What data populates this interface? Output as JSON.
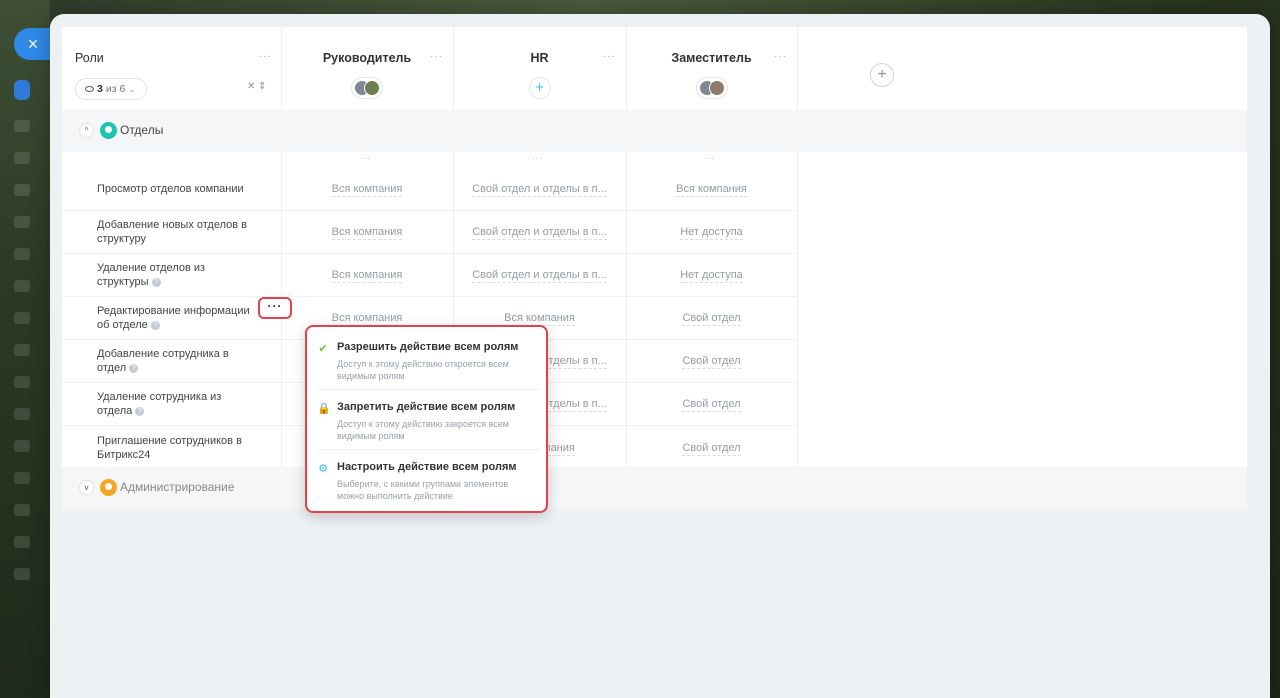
{
  "close_button": "×",
  "header": {
    "roles_title": "Роли",
    "dots": "···",
    "visible_count": "3",
    "visible_of": "из 6",
    "roles": [
      {
        "name": "Руководитель",
        "has_avatars": true
      },
      {
        "name": "HR",
        "has_avatars": false
      },
      {
        "name": "Заместитель",
        "has_avatars": true
      }
    ],
    "add_role_label": "+"
  },
  "sections": [
    {
      "label": "Отделы",
      "expanded": true,
      "icon": "people-icon",
      "color": "#1ec6b0"
    },
    {
      "label": "Администрирование",
      "expanded": false,
      "icon": "person-icon",
      "color": "#f6a623"
    }
  ],
  "permissions": [
    {
      "label": "Просмотр отделов компании",
      "help": false,
      "values": [
        "Вся компания",
        "Свой отдел и отделы в п...",
        "Вся компания"
      ]
    },
    {
      "label": "Добавление новых отделов в структуру",
      "help": false,
      "values": [
        "Вся компания",
        "Свой отдел и отделы в п...",
        "Нет доступа"
      ]
    },
    {
      "label": "Удаление отделов из структуры",
      "help": true,
      "values": [
        "Вся компания",
        "Свой отдел и отделы в п...",
        "Нет доступа"
      ]
    },
    {
      "label": "Редактирование информации об отделе",
      "help": true,
      "values": [
        "Вся компания",
        "Вся компания",
        "Свой отдел"
      ]
    },
    {
      "label": "Добавление сотрудника в отдел",
      "help": true,
      "values": [
        "",
        "Свой отдел и отделы в п...",
        "Свой отдел"
      ]
    },
    {
      "label": "Удаление сотрудника из отдела",
      "help": true,
      "values": [
        "",
        "Свой отдел и отделы в п...",
        "Свой отдел"
      ]
    },
    {
      "label": "Приглашение сотрудников в Битрикс24",
      "help": false,
      "values": [
        "",
        "Вся компания",
        "Свой отдел"
      ]
    }
  ],
  "row_menu": {
    "button_label": "···",
    "items": [
      {
        "title": "Разрешить действие всем ролям",
        "desc": "Доступ к этому действию откроется всем видимым ролям",
        "icon": "check-icon",
        "glyph": "✔"
      },
      {
        "title": "Запретить действие всем ролям",
        "desc": "Доступ к этому действию закроется всем видимым ролям",
        "icon": "lock-icon",
        "glyph": "🔒"
      },
      {
        "title": "Настроить действие всем ролям",
        "desc": "Выберите, с какими группами элементов можно выполнить действие",
        "icon": "gear-icon",
        "glyph": "⚙"
      }
    ]
  },
  "colors": {
    "accent": "#2f8ae8",
    "highlight": "#e0434a",
    "teal": "#1ec6b0",
    "orange": "#f6a623"
  }
}
